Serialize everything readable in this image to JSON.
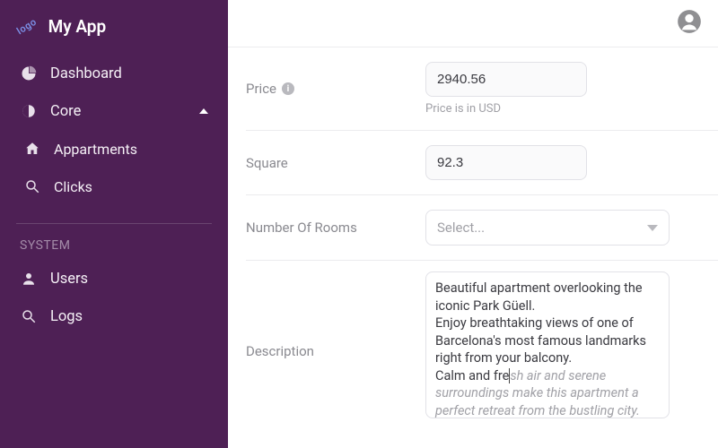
{
  "brand": {
    "logo_text": "logo",
    "name": "My App"
  },
  "sidebar": {
    "items": [
      {
        "label": "Dashboard"
      },
      {
        "label": "Core"
      },
      {
        "label": "Appartments"
      },
      {
        "label": "Clicks"
      }
    ],
    "system_label": "SYSTEM",
    "system_items": [
      {
        "label": "Users"
      },
      {
        "label": "Logs"
      }
    ]
  },
  "form": {
    "price": {
      "label": "Price",
      "value": "2940.56",
      "hint": "Price is in USD"
    },
    "square": {
      "label": "Square",
      "value": "92.3"
    },
    "rooms": {
      "label": "Number Of Rooms",
      "placeholder": "Select..."
    },
    "description": {
      "label": "Description",
      "typed": "Beautiful apartment overlooking the iconic Park Güell.\nEnjoy breathtaking views of one of Barcelona's most famous landmarks right from your balcony.\nCalm and fre",
      "ghost": "sh air and serene surroundings make this apartment a perfect retreat from the bustling city."
    }
  }
}
